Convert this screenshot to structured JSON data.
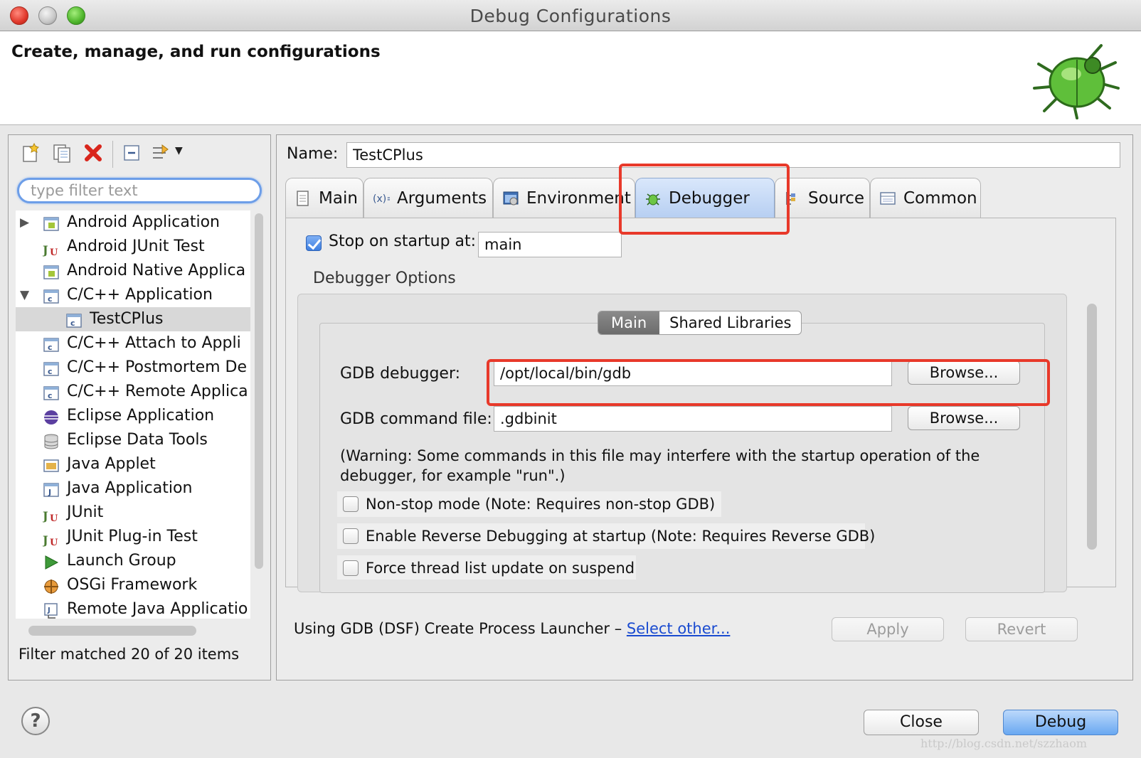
{
  "window": {
    "title": "Debug Configurations"
  },
  "banner": {
    "title": "Create, manage, and run configurations"
  },
  "left": {
    "filter_placeholder": "type filter text",
    "tree": [
      {
        "label": "Android Application",
        "icon": "android-app-icon",
        "expand": "collapsed",
        "indent": 0
      },
      {
        "label": "Android JUnit Test",
        "icon": "junit-icon",
        "expand": "none",
        "indent": 0
      },
      {
        "label": "Android Native Applica",
        "icon": "android-app-icon",
        "expand": "none",
        "indent": 0
      },
      {
        "label": "C/C++ Application",
        "icon": "c-app-icon",
        "expand": "expanded",
        "indent": 0
      },
      {
        "label": "TestCPlus",
        "icon": "c-app-icon",
        "expand": "none",
        "indent": 1,
        "selected": true
      },
      {
        "label": "C/C++ Attach to Appli",
        "icon": "c-app-icon",
        "expand": "none",
        "indent": 0
      },
      {
        "label": "C/C++ Postmortem De",
        "icon": "c-app-icon",
        "expand": "none",
        "indent": 0
      },
      {
        "label": "C/C++ Remote Applica",
        "icon": "c-app-icon",
        "expand": "none",
        "indent": 0
      },
      {
        "label": "Eclipse Application",
        "icon": "eclipse-icon",
        "expand": "none",
        "indent": 0
      },
      {
        "label": "Eclipse Data Tools",
        "icon": "database-icon",
        "expand": "none",
        "indent": 0
      },
      {
        "label": "Java Applet",
        "icon": "java-applet-icon",
        "expand": "none",
        "indent": 0
      },
      {
        "label": "Java Application",
        "icon": "java-app-icon",
        "expand": "none",
        "indent": 0
      },
      {
        "label": "JUnit",
        "icon": "junit-icon",
        "expand": "none",
        "indent": 0
      },
      {
        "label": "JUnit Plug-in Test",
        "icon": "junit-icon",
        "expand": "none",
        "indent": 0
      },
      {
        "label": "Launch Group",
        "icon": "launch-group-icon",
        "expand": "none",
        "indent": 0
      },
      {
        "label": "OSGi Framework",
        "icon": "osgi-icon",
        "expand": "none",
        "indent": 0
      },
      {
        "label": "Remote Java Applicatio",
        "icon": "remote-java-icon",
        "expand": "none",
        "indent": 0
      }
    ],
    "status": "Filter matched 20 of 20 items"
  },
  "right": {
    "name_label": "Name:",
    "name_value": "TestCPlus",
    "tabs": [
      {
        "label": "Main",
        "icon": "main-tab-icon"
      },
      {
        "label": "Arguments",
        "icon": "arguments-icon"
      },
      {
        "label": "Environment",
        "icon": "environment-icon"
      },
      {
        "label": "Debugger",
        "icon": "debugger-icon",
        "active": true
      },
      {
        "label": "Source",
        "icon": "source-icon"
      },
      {
        "label": "Common",
        "icon": "common-icon"
      }
    ],
    "stop_on_startup_label": "Stop on startup at:",
    "stop_on_startup_checked": true,
    "stop_on_startup_value": "main",
    "debugger_options_label": "Debugger Options",
    "subtabs": [
      "Main",
      "Shared Libraries"
    ],
    "gdb_debugger_label": "GDB debugger:",
    "gdb_debugger_value": "/opt/local/bin/gdb",
    "gdb_command_label": "GDB command file:",
    "gdb_command_value": ".gdbinit",
    "browse_label": "Browse...",
    "warning": "(Warning: Some commands in this file may interfere with the startup operation of the debugger, for example \"run\".)",
    "options": [
      {
        "label": "Non-stop mode (Note: Requires non-stop GDB)",
        "checked": false
      },
      {
        "label": "Enable Reverse Debugging at startup (Note: Requires Reverse GDB)",
        "checked": false
      },
      {
        "label": "Force thread list update on suspend",
        "checked": false
      }
    ],
    "launcher_text": "Using GDB (DSF) Create Process Launcher – ",
    "launcher_link": "Select other...",
    "apply_label": "Apply",
    "revert_label": "Revert"
  },
  "footer": {
    "close_label": "Close",
    "debug_label": "Debug",
    "help_icon": "help-icon"
  },
  "watermark": "http://blog.csdn.net/szzhaom",
  "colors": {
    "highlight": "#e8392a",
    "primary_button": "#69a8f1",
    "link": "#1a4bd0"
  }
}
